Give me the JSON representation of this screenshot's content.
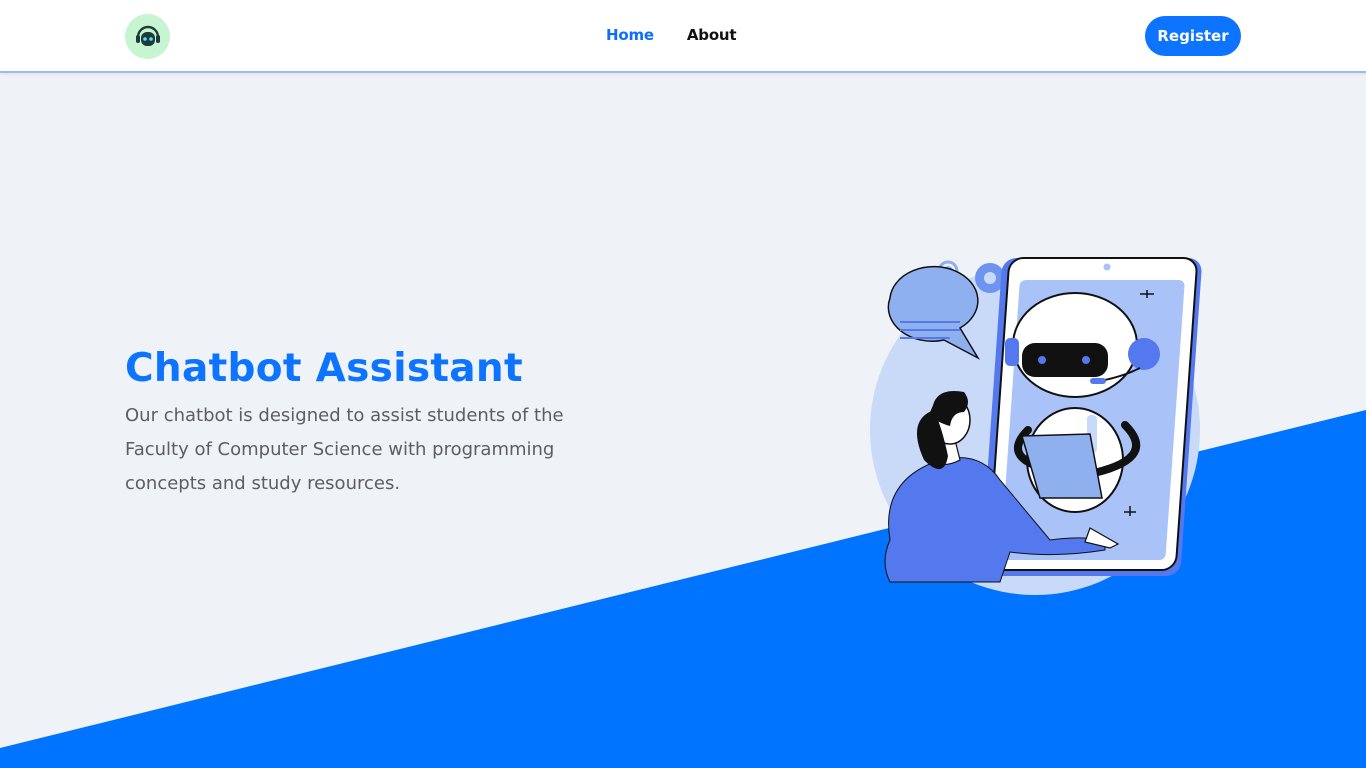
{
  "nav": {
    "logo_icon": "robot-head-icon",
    "links": [
      {
        "label": "Home",
        "active": true
      },
      {
        "label": "About",
        "active": false
      }
    ],
    "register_label": "Register"
  },
  "hero": {
    "title": "Chatbot Assistant",
    "description": "Our chatbot is designed to assist students of the Faculty of Computer Science with programming concepts and study resources.",
    "illustration_icon": "chatbot-phone-illustration"
  },
  "colors": {
    "accent": "#0d74ff",
    "background": "#eff2f7",
    "text_muted": "#5d5d63",
    "illustration_blue": "#5478ee"
  }
}
